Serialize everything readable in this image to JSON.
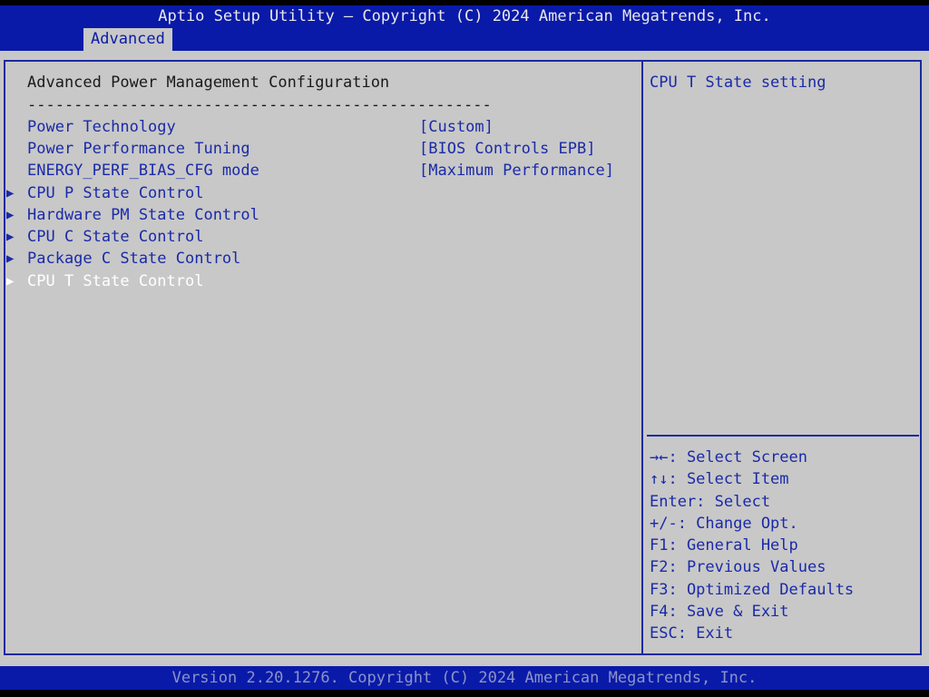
{
  "header": {
    "title": "Aptio Setup Utility – Copyright (C) 2024 American Megatrends, Inc.",
    "active_tab": "Advanced"
  },
  "main": {
    "heading": "Advanced Power Management Configuration",
    "separator": "--------------------------------------------------",
    "settings": [
      {
        "label": "Power Technology",
        "value": "[Custom]"
      },
      {
        "label": "Power Performance Tuning",
        "value": "[BIOS Controls EPB]"
      },
      {
        "label": "ENERGY_PERF_BIAS_CFG mode",
        "value": "[Maximum Performance]"
      }
    ],
    "submenus": [
      {
        "label": "CPU P State Control"
      },
      {
        "label": "Hardware PM State Control"
      },
      {
        "label": "CPU C State Control"
      },
      {
        "label": "Package C State Control"
      },
      {
        "label": "CPU T State Control",
        "selected": true
      }
    ],
    "submenu_arrow_glyph": "▶"
  },
  "help": {
    "text": "CPU T State setting",
    "keys": [
      "→←: Select Screen",
      "↑↓: Select Item",
      "Enter: Select",
      "+/-: Change Opt.",
      "F1: General Help",
      "F2: Previous Values",
      "F3: Optimized Defaults",
      "F4: Save & Exit",
      "ESC: Exit"
    ]
  },
  "footer": {
    "version": "Version 2.20.1276. Copyright (C) 2024 American Megatrends, Inc."
  },
  "colors": {
    "header_blue": "#0a1aa8",
    "background_gray": "#c8c8c8",
    "item_blue": "#1a2aa8",
    "selected_white": "#ffffff"
  }
}
